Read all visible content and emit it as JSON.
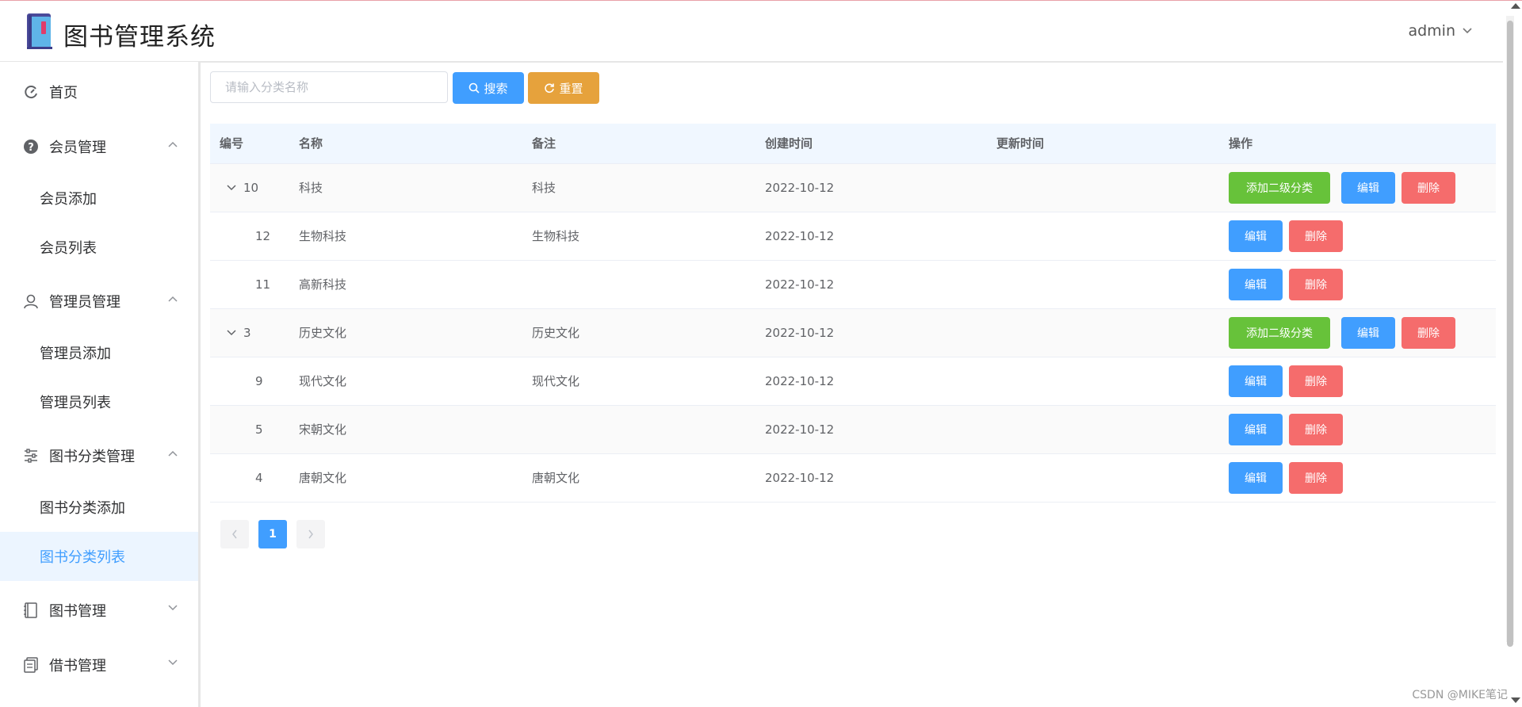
{
  "app": {
    "title": "图书管理系统",
    "user": "admin"
  },
  "sidebar": {
    "home": "首页",
    "member": {
      "label": "会员管理",
      "items": [
        "会员添加",
        "会员列表"
      ]
    },
    "admin": {
      "label": "管理员管理",
      "items": [
        "管理员添加",
        "管理员列表"
      ]
    },
    "category": {
      "label": "图书分类管理",
      "items": [
        "图书分类添加",
        "图书分类列表"
      ],
      "active_item": "图书分类列表"
    },
    "book": {
      "label": "图书管理"
    },
    "borrow": {
      "label": "借书管理"
    }
  },
  "search": {
    "placeholder": "请输入分类名称",
    "value": "",
    "search_label": "搜索",
    "reset_label": "重置"
  },
  "table": {
    "columns": [
      "编号",
      "名称",
      "备注",
      "创建时间",
      "更新时间",
      "操作"
    ],
    "rows": [
      {
        "id": "10",
        "name": "科技",
        "remark": "科技",
        "created": "2022-10-12",
        "updated": "",
        "level": 1,
        "expanded": true
      },
      {
        "id": "12",
        "name": "生物科技",
        "remark": "生物科技",
        "created": "2022-10-12",
        "updated": "",
        "level": 2
      },
      {
        "id": "11",
        "name": "高新科技",
        "remark": "",
        "created": "2022-10-12",
        "updated": "",
        "level": 2
      },
      {
        "id": "3",
        "name": "历史文化",
        "remark": "历史文化",
        "created": "2022-10-12",
        "updated": "",
        "level": 1,
        "expanded": true
      },
      {
        "id": "9",
        "name": "现代文化",
        "remark": "现代文化",
        "created": "2022-10-12",
        "updated": "",
        "level": 2
      },
      {
        "id": "5",
        "name": "宋朝文化",
        "remark": "",
        "created": "2022-10-12",
        "updated": "",
        "level": 2
      },
      {
        "id": "4",
        "name": "唐朝文化",
        "remark": "唐朝文化",
        "created": "2022-10-12",
        "updated": "",
        "level": 2
      }
    ],
    "actions": {
      "add_sub": "添加二级分类",
      "edit": "编辑",
      "delete": "删除"
    }
  },
  "pagination": {
    "current": "1",
    "prev_icon": "chevron-left-icon",
    "next_icon": "chevron-right-icon"
  },
  "watermark": "CSDN @MIKE笔记",
  "colors": {
    "primary": "#409eff",
    "success": "#67c23a",
    "warning": "#e6a23c",
    "danger": "#f56c6c",
    "active_bg": "#ecf5ff"
  }
}
